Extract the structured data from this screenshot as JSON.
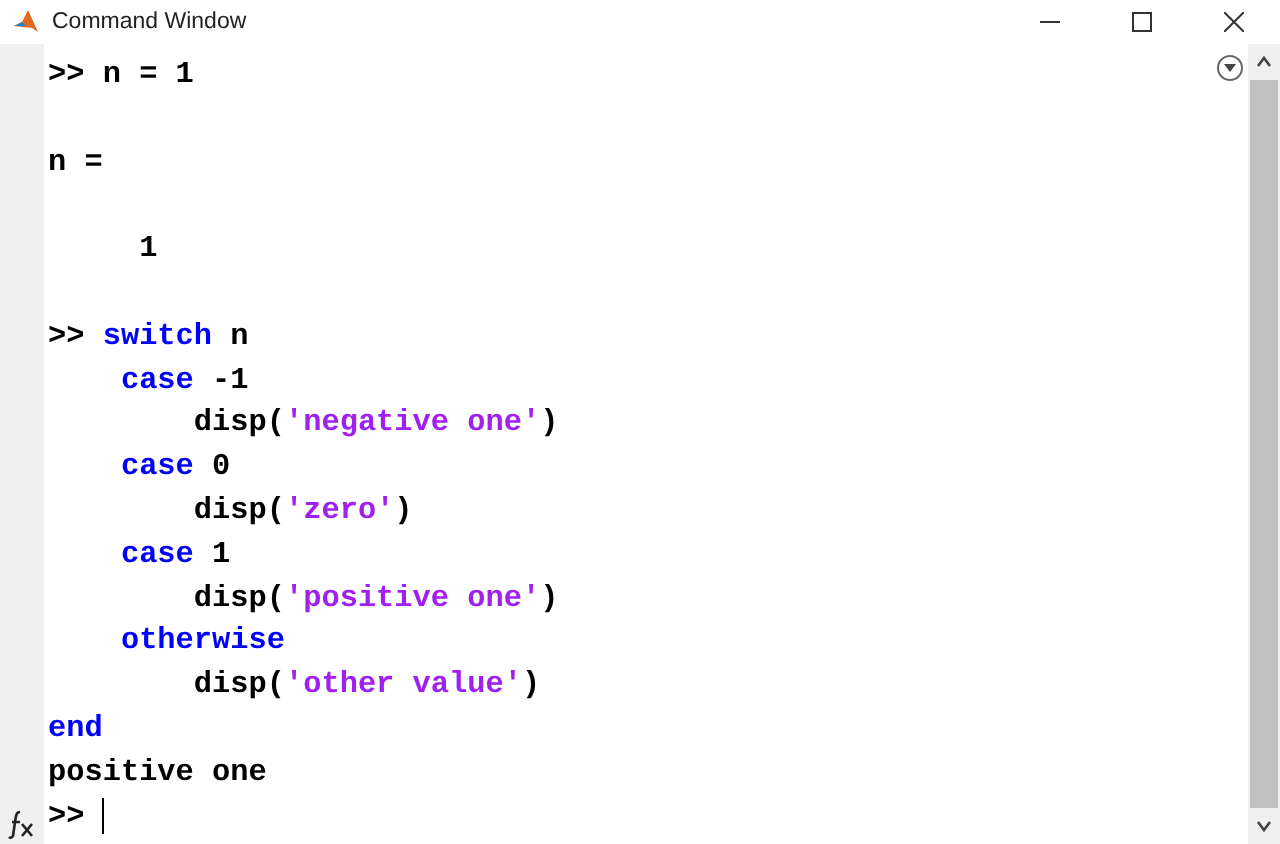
{
  "window": {
    "title": "Command Window"
  },
  "lines": [
    {
      "kind": "code",
      "segments": [
        {
          "kind": "plain",
          "text": ">> n = 1"
        }
      ]
    },
    {
      "kind": "blank"
    },
    {
      "kind": "code",
      "segments": [
        {
          "kind": "plain",
          "text": "n ="
        }
      ]
    },
    {
      "kind": "blank"
    },
    {
      "kind": "code",
      "segments": [
        {
          "kind": "plain",
          "text": "     1"
        }
      ]
    },
    {
      "kind": "blank"
    },
    {
      "kind": "code",
      "segments": [
        {
          "kind": "plain",
          "text": ">> "
        },
        {
          "kind": "keyword",
          "text": "switch"
        },
        {
          "kind": "plain",
          "text": " n"
        }
      ]
    },
    {
      "kind": "code",
      "segments": [
        {
          "kind": "keyword",
          "text": "    case"
        },
        {
          "kind": "plain",
          "text": " -1"
        }
      ]
    },
    {
      "kind": "code",
      "segments": [
        {
          "kind": "plain",
          "text": "        disp("
        },
        {
          "kind": "string",
          "text": "'negative one'"
        },
        {
          "kind": "plain",
          "text": ")"
        }
      ]
    },
    {
      "kind": "code",
      "segments": [
        {
          "kind": "keyword",
          "text": "    case"
        },
        {
          "kind": "plain",
          "text": " 0"
        }
      ]
    },
    {
      "kind": "code",
      "segments": [
        {
          "kind": "plain",
          "text": "        disp("
        },
        {
          "kind": "string",
          "text": "'zero'"
        },
        {
          "kind": "plain",
          "text": ")"
        }
      ]
    },
    {
      "kind": "code",
      "segments": [
        {
          "kind": "keyword",
          "text": "    case"
        },
        {
          "kind": "plain",
          "text": " 1"
        }
      ]
    },
    {
      "kind": "code",
      "segments": [
        {
          "kind": "plain",
          "text": "        disp("
        },
        {
          "kind": "string",
          "text": "'positive one'"
        },
        {
          "kind": "plain",
          "text": ")"
        }
      ]
    },
    {
      "kind": "code",
      "segments": [
        {
          "kind": "keyword",
          "text": "    otherwise"
        }
      ]
    },
    {
      "kind": "code",
      "segments": [
        {
          "kind": "plain",
          "text": "        disp("
        },
        {
          "kind": "string",
          "text": "'other value'"
        },
        {
          "kind": "plain",
          "text": ")"
        }
      ]
    },
    {
      "kind": "code",
      "segments": [
        {
          "kind": "keyword",
          "text": "end"
        }
      ]
    },
    {
      "kind": "code",
      "segments": [
        {
          "kind": "plain",
          "text": "positive one"
        }
      ]
    }
  ],
  "prompt": {
    "text": ">>"
  }
}
